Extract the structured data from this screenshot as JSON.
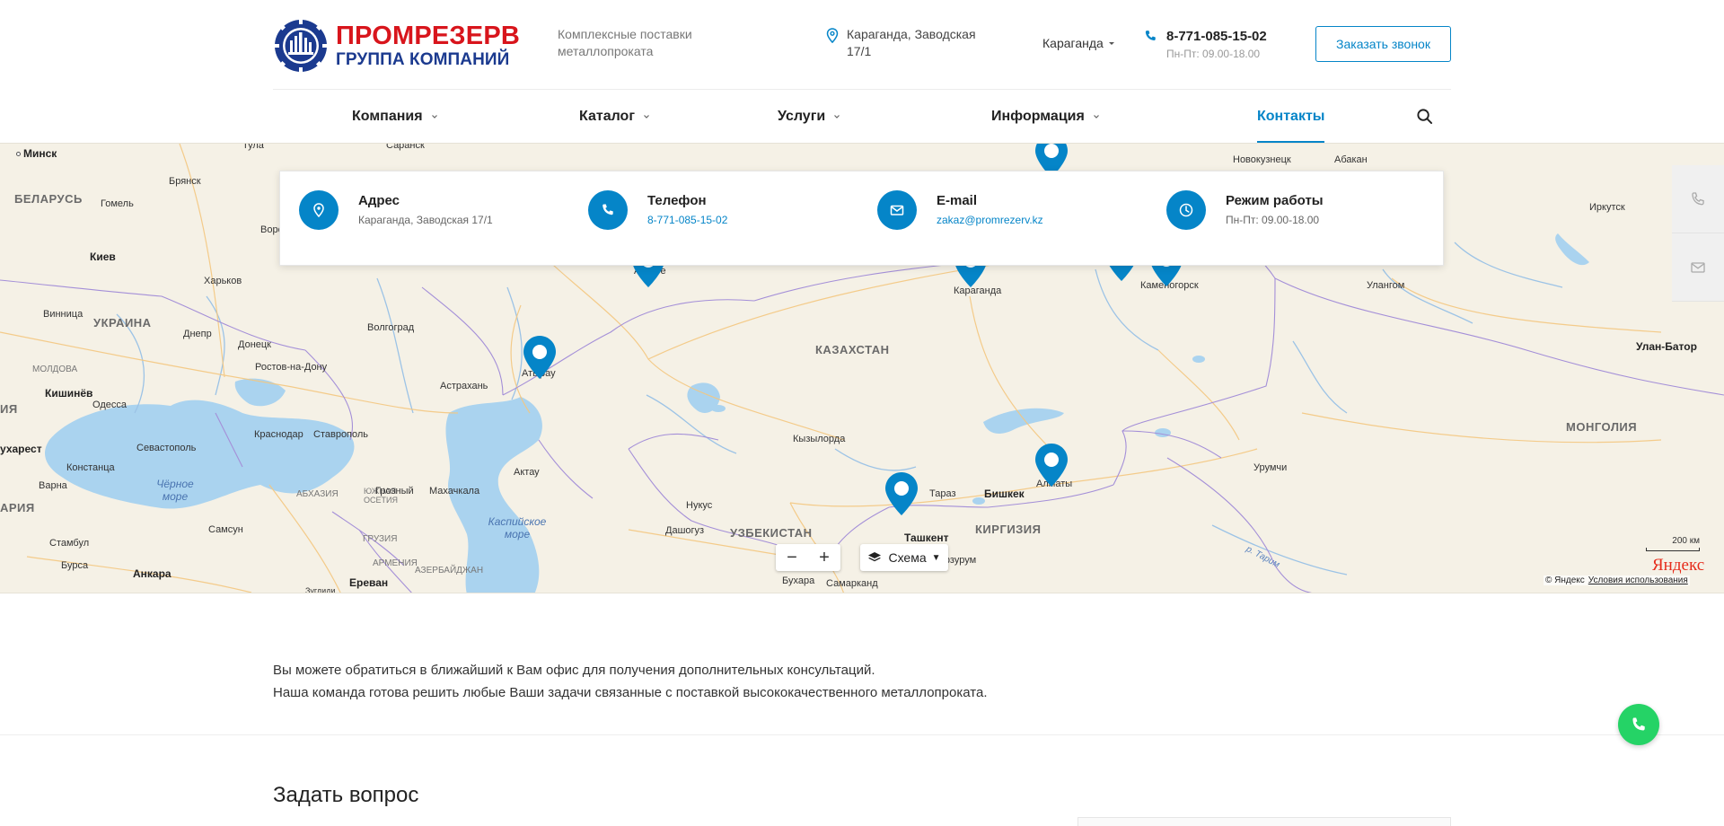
{
  "header": {
    "logo_line1": "ПРОМРЕЗЕРВ",
    "logo_line2": "ГРУППА КОМПАНИЙ",
    "slogan": "Комплексные поставки металлопроката",
    "address": "Караганда, Заводская 17/1",
    "city": "Караганда",
    "phone": "8-771-085-15-02",
    "hours": "Пн-Пт: 09.00-18.00",
    "callback_label": "Заказать звонок"
  },
  "nav": {
    "items": [
      {
        "label": "Компания",
        "has_dropdown": true
      },
      {
        "label": "Каталог",
        "has_dropdown": true
      },
      {
        "label": "Услуги",
        "has_dropdown": true
      },
      {
        "label": "Информация",
        "has_dropdown": true
      },
      {
        "label": "Контакты",
        "has_dropdown": false,
        "active": true
      }
    ]
  },
  "contact_card": {
    "address": {
      "title": "Адрес",
      "value": "Караганда, Заводская 17/1",
      "icon": "location-pin-icon"
    },
    "phone": {
      "title": "Телефон",
      "value": "8-771-085-15-02",
      "icon": "phone-icon"
    },
    "email": {
      "title": "E-mail",
      "value": "zakaz@promrezerv.kz",
      "icon": "mail-icon"
    },
    "hours": {
      "title": "Режим работы",
      "value": "Пн-Пт: 09.00-18.00",
      "icon": "clock-icon"
    }
  },
  "map": {
    "labels": {
      "countries": [
        "БЕЛАРУСЬ",
        "УКРАИНА",
        "КАЗАХСТАН",
        "УЗБЕКИСТАН",
        "КИРГИЗИЯ",
        "МОНГОЛИЯ",
        "МОЛДОВА",
        "АБХАЗИЯ",
        "ГРУЗИЯ",
        "АРМЕНИЯ",
        "АЗЕРБАЙДЖАН",
        "ЮЖНАЯ ОСЕТИЯ",
        "ИЯ",
        "АРИЯ"
      ],
      "capitals": [
        "Минск",
        "Киев",
        "Кишинёв",
        "Бишкек",
        "Ташкент",
        "Улан-Батор",
        "Анкара",
        "Ереван",
        "ухарест"
      ],
      "cities": [
        "Брянск",
        "Гомель",
        "Харьков",
        "Винница",
        "Днепр",
        "Донецк",
        "Волгоград",
        "Ростов-на-Дону",
        "Одесса",
        "Астрахань",
        "Севастополь",
        "Краснодар",
        "Ставрополь",
        "Констанца",
        "Варна",
        "Грозный",
        "Махачкала",
        "Самсун",
        "Стамбул",
        "Бурса",
        "Актау",
        "Нукус",
        "Дашогуз",
        "Кызылорда",
        "Тараз",
        "Алматы",
        "Караганда",
        "Каменогорск",
        "Актобе",
        "Атырау",
        "Иркутск",
        "Улангом",
        "Урумчи",
        "Бухара",
        "Самарканд",
        "Новокузнецк",
        "Абакан",
        "Саранск",
        "Тула",
        "Воронеж",
        "Зугдиди",
        "Эрзурум"
      ],
      "seas": [
        "Чёрное море",
        "Каспийское море"
      ],
      "rivers": [
        "р. Тарим"
      ]
    },
    "zoom_out": "−",
    "zoom_in": "+",
    "layer_label": "Схема",
    "scale": "200 км",
    "provider": "Яндекс",
    "copyright": "© Яндекс",
    "terms": "Условия использования"
  },
  "content": {
    "intro_line1": "Вы можете обратиться в ближайший к Вам офис для получения дополнительных консультаций.",
    "intro_line2": "Наша команда готова решить любые Ваши задачи связанные с поставкой высококачественного металлопроката.",
    "ask_title": "Задать вопрос"
  },
  "colors": {
    "accent": "#0585c8",
    "brand_red": "#d8151c",
    "brand_blue": "#1b3a8f",
    "whatsapp": "#25d366"
  }
}
